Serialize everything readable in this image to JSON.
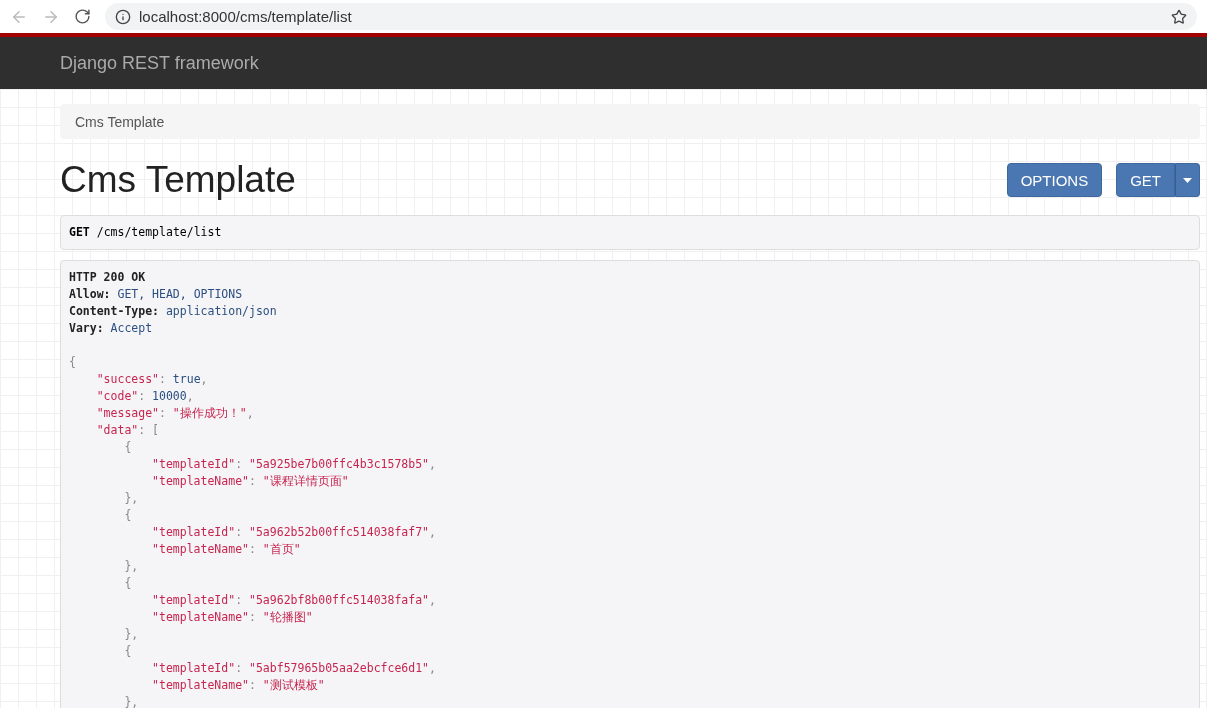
{
  "browser": {
    "url": "localhost:8000/cms/template/list",
    "back_disabled": true
  },
  "navbar": {
    "brand": "Django REST framework"
  },
  "breadcrumb": [
    {
      "label": "Cms Template",
      "selected": true
    }
  ],
  "page": {
    "title": "Cms Template",
    "buttons": [
      {
        "label": "OPTIONS",
        "kind": "plain"
      },
      {
        "label": "GET",
        "kind": "split"
      }
    ]
  },
  "request": {
    "method": "GET",
    "path": "/cms/template/list"
  },
  "response": {
    "headers": [
      {
        "tokens": [
          {
            "kind": "hkey",
            "text": "HTTP 200 OK"
          }
        ]
      },
      {
        "tokens": [
          {
            "kind": "hkey",
            "text": "Allow:"
          },
          {
            "kind": "hval",
            "text": " GET, HEAD, OPTIONS"
          }
        ]
      },
      {
        "tokens": [
          {
            "kind": "hkey",
            "text": "Content-Type:"
          },
          {
            "kind": "hval",
            "text": " application/json"
          }
        ]
      },
      {
        "tokens": [
          {
            "kind": "hkey",
            "text": "Vary:"
          },
          {
            "kind": "hval",
            "text": " Accept"
          }
        ]
      }
    ],
    "body": [
      {
        "tokens": [
          {
            "kind": "punct",
            "text": "{"
          }
        ],
        "children": [
          {
            "tokens": [
              {
                "kind": "str",
                "text": "\"success\""
              },
              {
                "kind": "punct",
                "text": ": "
              },
              {
                "kind": "lit",
                "text": "true"
              },
              {
                "kind": "punct",
                "text": ","
              }
            ]
          },
          {
            "tokens": [
              {
                "kind": "str",
                "text": "\"code\""
              },
              {
                "kind": "punct",
                "text": ": "
              },
              {
                "kind": "lit",
                "text": "10000"
              },
              {
                "kind": "punct",
                "text": ","
              }
            ]
          },
          {
            "tokens": [
              {
                "kind": "str",
                "text": "\"message\""
              },
              {
                "kind": "punct",
                "text": ": "
              },
              {
                "kind": "str",
                "text": "\"操作成功！\""
              },
              {
                "kind": "punct",
                "text": ","
              }
            ]
          },
          {
            "tokens": [
              {
                "kind": "str",
                "text": "\"data\""
              },
              {
                "kind": "punct",
                "text": ": ["
              }
            ],
            "children": [
              {
                "tokens": [
                  {
                    "kind": "punct",
                    "text": "{"
                  }
                ],
                "children": [
                  {
                    "tokens": [
                      {
                        "kind": "str",
                        "text": "\"templateId\""
                      },
                      {
                        "kind": "punct",
                        "text": ": "
                      },
                      {
                        "kind": "str",
                        "text": "\"5a925be7b00ffc4b3c1578b5\""
                      },
                      {
                        "kind": "punct",
                        "text": ","
                      }
                    ]
                  },
                  {
                    "tokens": [
                      {
                        "kind": "str",
                        "text": "\"templateName\""
                      },
                      {
                        "kind": "punct",
                        "text": ": "
                      },
                      {
                        "kind": "str",
                        "text": "\"课程详情页面\""
                      }
                    ]
                  }
                ]
              },
              {
                "tokens": [
                  {
                    "kind": "punct",
                    "text": "},"
                  }
                ]
              },
              {
                "tokens": [
                  {
                    "kind": "punct",
                    "text": "{"
                  }
                ],
                "children": [
                  {
                    "tokens": [
                      {
                        "kind": "str",
                        "text": "\"templateId\""
                      },
                      {
                        "kind": "punct",
                        "text": ": "
                      },
                      {
                        "kind": "str",
                        "text": "\"5a962b52b00ffc514038faf7\""
                      },
                      {
                        "kind": "punct",
                        "text": ","
                      }
                    ]
                  },
                  {
                    "tokens": [
                      {
                        "kind": "str",
                        "text": "\"templateName\""
                      },
                      {
                        "kind": "punct",
                        "text": ": "
                      },
                      {
                        "kind": "str",
                        "text": "\"首页\""
                      }
                    ]
                  }
                ]
              },
              {
                "tokens": [
                  {
                    "kind": "punct",
                    "text": "},"
                  }
                ]
              },
              {
                "tokens": [
                  {
                    "kind": "punct",
                    "text": "{"
                  }
                ],
                "children": [
                  {
                    "tokens": [
                      {
                        "kind": "str",
                        "text": "\"templateId\""
                      },
                      {
                        "kind": "punct",
                        "text": ": "
                      },
                      {
                        "kind": "str",
                        "text": "\"5a962bf8b00ffc514038fafa\""
                      },
                      {
                        "kind": "punct",
                        "text": ","
                      }
                    ]
                  },
                  {
                    "tokens": [
                      {
                        "kind": "str",
                        "text": "\"templateName\""
                      },
                      {
                        "kind": "punct",
                        "text": ": "
                      },
                      {
                        "kind": "str",
                        "text": "\"轮播图\""
                      }
                    ]
                  }
                ]
              },
              {
                "tokens": [
                  {
                    "kind": "punct",
                    "text": "},"
                  }
                ]
              },
              {
                "tokens": [
                  {
                    "kind": "punct",
                    "text": "{"
                  }
                ],
                "children": [
                  {
                    "tokens": [
                      {
                        "kind": "str",
                        "text": "\"templateId\""
                      },
                      {
                        "kind": "punct",
                        "text": ": "
                      },
                      {
                        "kind": "str",
                        "text": "\"5abf57965b05aa2ebcfce6d1\""
                      },
                      {
                        "kind": "punct",
                        "text": ","
                      }
                    ]
                  },
                  {
                    "tokens": [
                      {
                        "kind": "str",
                        "text": "\"templateName\""
                      },
                      {
                        "kind": "punct",
                        "text": ": "
                      },
                      {
                        "kind": "str",
                        "text": "\"测试模板\""
                      }
                    ]
                  }
                ]
              },
              {
                "tokens": [
                  {
                    "kind": "punct",
                    "text": "},"
                  }
                ]
              }
            ]
          }
        ]
      }
    ]
  }
}
